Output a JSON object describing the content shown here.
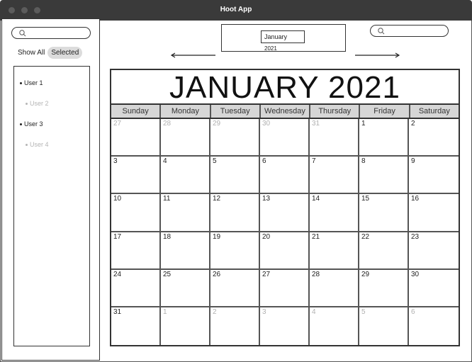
{
  "window": {
    "title": "Hoot App"
  },
  "sidebar": {
    "filters": {
      "show_all": "Show All",
      "selected": "Selected"
    },
    "users": [
      {
        "label": "User 1",
        "state": "active"
      },
      {
        "label": "User 2",
        "state": "inactive"
      },
      {
        "label": "User 3",
        "state": "active"
      },
      {
        "label": "User 4",
        "state": "inactive"
      }
    ]
  },
  "header": {
    "month_input_value": "January",
    "year_partial": "2021"
  },
  "calendar": {
    "title": "JANUARY 2021",
    "weekdays": [
      "Sunday",
      "Monday",
      "Tuesday",
      "Wednesday",
      "Thursday",
      "Friday",
      "Saturday"
    ],
    "weeks": [
      [
        {
          "d": "27",
          "m": true
        },
        {
          "d": "28",
          "m": true
        },
        {
          "d": "29",
          "m": true
        },
        {
          "d": "30",
          "m": true
        },
        {
          "d": "31",
          "m": true
        },
        {
          "d": "1",
          "m": false
        },
        {
          "d": "2",
          "m": false
        }
      ],
      [
        {
          "d": "3",
          "m": false
        },
        {
          "d": "4",
          "m": false
        },
        {
          "d": "5",
          "m": false
        },
        {
          "d": "6",
          "m": false
        },
        {
          "d": "7",
          "m": false
        },
        {
          "d": "8",
          "m": false
        },
        {
          "d": "9",
          "m": false
        }
      ],
      [
        {
          "d": "10",
          "m": false
        },
        {
          "d": "11",
          "m": false
        },
        {
          "d": "12",
          "m": false
        },
        {
          "d": "13",
          "m": false
        },
        {
          "d": "14",
          "m": false
        },
        {
          "d": "15",
          "m": false
        },
        {
          "d": "16",
          "m": false
        }
      ],
      [
        {
          "d": "17",
          "m": false
        },
        {
          "d": "18",
          "m": false
        },
        {
          "d": "19",
          "m": false
        },
        {
          "d": "20",
          "m": false
        },
        {
          "d": "21",
          "m": false
        },
        {
          "d": "22",
          "m": false
        },
        {
          "d": "23",
          "m": false
        }
      ],
      [
        {
          "d": "24",
          "m": false
        },
        {
          "d": "25",
          "m": false
        },
        {
          "d": "26",
          "m": false
        },
        {
          "d": "27",
          "m": false
        },
        {
          "d": "28",
          "m": false
        },
        {
          "d": "29",
          "m": false
        },
        {
          "d": "30",
          "m": false
        }
      ],
      [
        {
          "d": "31",
          "m": false
        },
        {
          "d": "1",
          "m": true
        },
        {
          "d": "2",
          "m": true
        },
        {
          "d": "3",
          "m": true
        },
        {
          "d": "4",
          "m": true
        },
        {
          "d": "5",
          "m": true
        },
        {
          "d": "6",
          "m": true
        }
      ]
    ]
  },
  "icons": {
    "search": "search-icon",
    "prev": "arrow-left-icon",
    "next": "arrow-right-icon"
  },
  "colors": {
    "titlebar": "#3a3a3a",
    "weekday_header": "#d6d6d6",
    "muted_text": "#b0b0b0"
  }
}
